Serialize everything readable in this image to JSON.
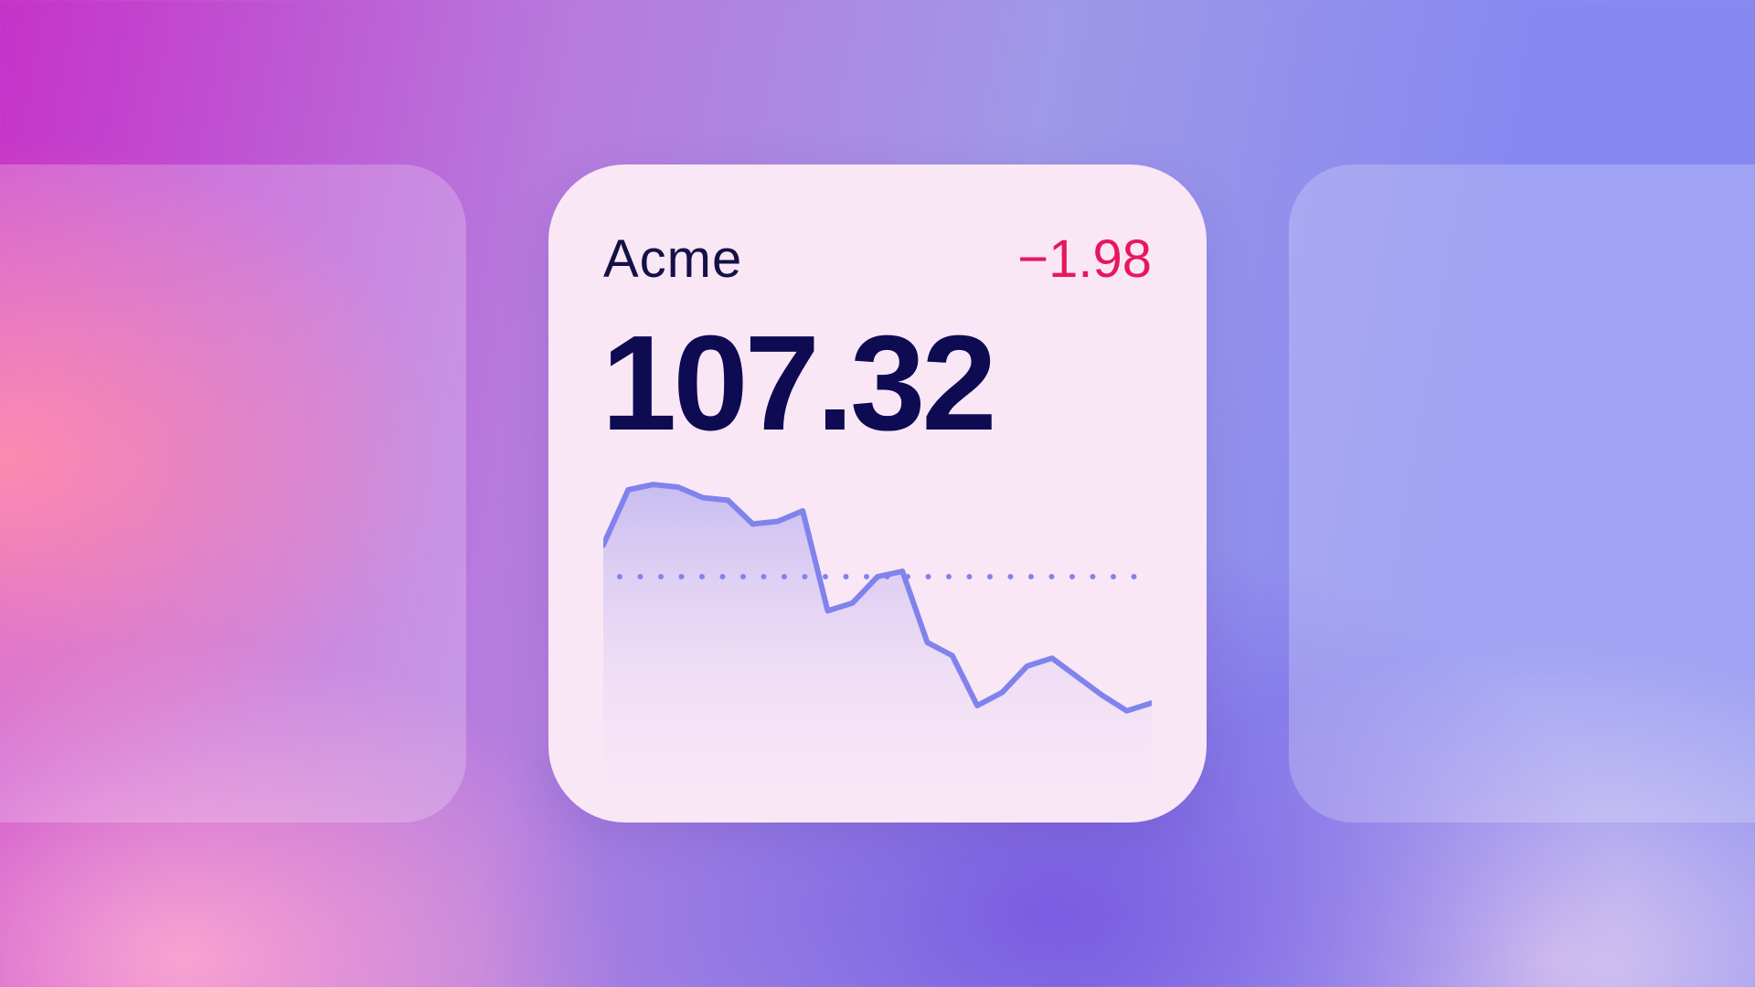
{
  "widget": {
    "ticker": "Acme",
    "change": "−1.98",
    "price": "107.32"
  },
  "colors": {
    "line": "#8083ec",
    "negative": "#e8175d",
    "price_text": "#0f0b52",
    "card_bg": "#f9e7f6"
  },
  "chart_data": {
    "type": "area",
    "y": [
      1.0,
      0.79,
      0.77,
      0.78,
      0.82,
      0.83,
      0.92,
      0.91,
      0.87,
      1.25,
      1.22,
      1.12,
      1.1,
      1.37,
      1.42,
      1.61,
      1.56,
      1.46,
      1.43,
      1.5,
      1.57,
      1.63,
      1.6
    ],
    "baseline": 1.12,
    "ylim": [
      0.7,
      1.95
    ]
  }
}
